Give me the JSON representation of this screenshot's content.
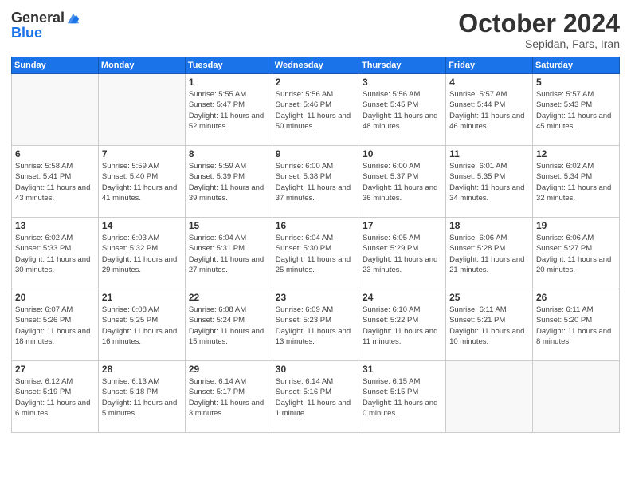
{
  "header": {
    "logo_general": "General",
    "logo_blue": "Blue",
    "month_title": "October 2024",
    "location": "Sepidan, Fars, Iran"
  },
  "days_of_week": [
    "Sunday",
    "Monday",
    "Tuesday",
    "Wednesday",
    "Thursday",
    "Friday",
    "Saturday"
  ],
  "weeks": [
    [
      {
        "day": "",
        "detail": ""
      },
      {
        "day": "",
        "detail": ""
      },
      {
        "day": "1",
        "detail": "Sunrise: 5:55 AM\nSunset: 5:47 PM\nDaylight: 11 hours and 52 minutes."
      },
      {
        "day": "2",
        "detail": "Sunrise: 5:56 AM\nSunset: 5:46 PM\nDaylight: 11 hours and 50 minutes."
      },
      {
        "day": "3",
        "detail": "Sunrise: 5:56 AM\nSunset: 5:45 PM\nDaylight: 11 hours and 48 minutes."
      },
      {
        "day": "4",
        "detail": "Sunrise: 5:57 AM\nSunset: 5:44 PM\nDaylight: 11 hours and 46 minutes."
      },
      {
        "day": "5",
        "detail": "Sunrise: 5:57 AM\nSunset: 5:43 PM\nDaylight: 11 hours and 45 minutes."
      }
    ],
    [
      {
        "day": "6",
        "detail": "Sunrise: 5:58 AM\nSunset: 5:41 PM\nDaylight: 11 hours and 43 minutes."
      },
      {
        "day": "7",
        "detail": "Sunrise: 5:59 AM\nSunset: 5:40 PM\nDaylight: 11 hours and 41 minutes."
      },
      {
        "day": "8",
        "detail": "Sunrise: 5:59 AM\nSunset: 5:39 PM\nDaylight: 11 hours and 39 minutes."
      },
      {
        "day": "9",
        "detail": "Sunrise: 6:00 AM\nSunset: 5:38 PM\nDaylight: 11 hours and 37 minutes."
      },
      {
        "day": "10",
        "detail": "Sunrise: 6:00 AM\nSunset: 5:37 PM\nDaylight: 11 hours and 36 minutes."
      },
      {
        "day": "11",
        "detail": "Sunrise: 6:01 AM\nSunset: 5:35 PM\nDaylight: 11 hours and 34 minutes."
      },
      {
        "day": "12",
        "detail": "Sunrise: 6:02 AM\nSunset: 5:34 PM\nDaylight: 11 hours and 32 minutes."
      }
    ],
    [
      {
        "day": "13",
        "detail": "Sunrise: 6:02 AM\nSunset: 5:33 PM\nDaylight: 11 hours and 30 minutes."
      },
      {
        "day": "14",
        "detail": "Sunrise: 6:03 AM\nSunset: 5:32 PM\nDaylight: 11 hours and 29 minutes."
      },
      {
        "day": "15",
        "detail": "Sunrise: 6:04 AM\nSunset: 5:31 PM\nDaylight: 11 hours and 27 minutes."
      },
      {
        "day": "16",
        "detail": "Sunrise: 6:04 AM\nSunset: 5:30 PM\nDaylight: 11 hours and 25 minutes."
      },
      {
        "day": "17",
        "detail": "Sunrise: 6:05 AM\nSunset: 5:29 PM\nDaylight: 11 hours and 23 minutes."
      },
      {
        "day": "18",
        "detail": "Sunrise: 6:06 AM\nSunset: 5:28 PM\nDaylight: 11 hours and 21 minutes."
      },
      {
        "day": "19",
        "detail": "Sunrise: 6:06 AM\nSunset: 5:27 PM\nDaylight: 11 hours and 20 minutes."
      }
    ],
    [
      {
        "day": "20",
        "detail": "Sunrise: 6:07 AM\nSunset: 5:26 PM\nDaylight: 11 hours and 18 minutes."
      },
      {
        "day": "21",
        "detail": "Sunrise: 6:08 AM\nSunset: 5:25 PM\nDaylight: 11 hours and 16 minutes."
      },
      {
        "day": "22",
        "detail": "Sunrise: 6:08 AM\nSunset: 5:24 PM\nDaylight: 11 hours and 15 minutes."
      },
      {
        "day": "23",
        "detail": "Sunrise: 6:09 AM\nSunset: 5:23 PM\nDaylight: 11 hours and 13 minutes."
      },
      {
        "day": "24",
        "detail": "Sunrise: 6:10 AM\nSunset: 5:22 PM\nDaylight: 11 hours and 11 minutes."
      },
      {
        "day": "25",
        "detail": "Sunrise: 6:11 AM\nSunset: 5:21 PM\nDaylight: 11 hours and 10 minutes."
      },
      {
        "day": "26",
        "detail": "Sunrise: 6:11 AM\nSunset: 5:20 PM\nDaylight: 11 hours and 8 minutes."
      }
    ],
    [
      {
        "day": "27",
        "detail": "Sunrise: 6:12 AM\nSunset: 5:19 PM\nDaylight: 11 hours and 6 minutes."
      },
      {
        "day": "28",
        "detail": "Sunrise: 6:13 AM\nSunset: 5:18 PM\nDaylight: 11 hours and 5 minutes."
      },
      {
        "day": "29",
        "detail": "Sunrise: 6:14 AM\nSunset: 5:17 PM\nDaylight: 11 hours and 3 minutes."
      },
      {
        "day": "30",
        "detail": "Sunrise: 6:14 AM\nSunset: 5:16 PM\nDaylight: 11 hours and 1 minute."
      },
      {
        "day": "31",
        "detail": "Sunrise: 6:15 AM\nSunset: 5:15 PM\nDaylight: 11 hours and 0 minutes."
      },
      {
        "day": "",
        "detail": ""
      },
      {
        "day": "",
        "detail": ""
      }
    ]
  ]
}
